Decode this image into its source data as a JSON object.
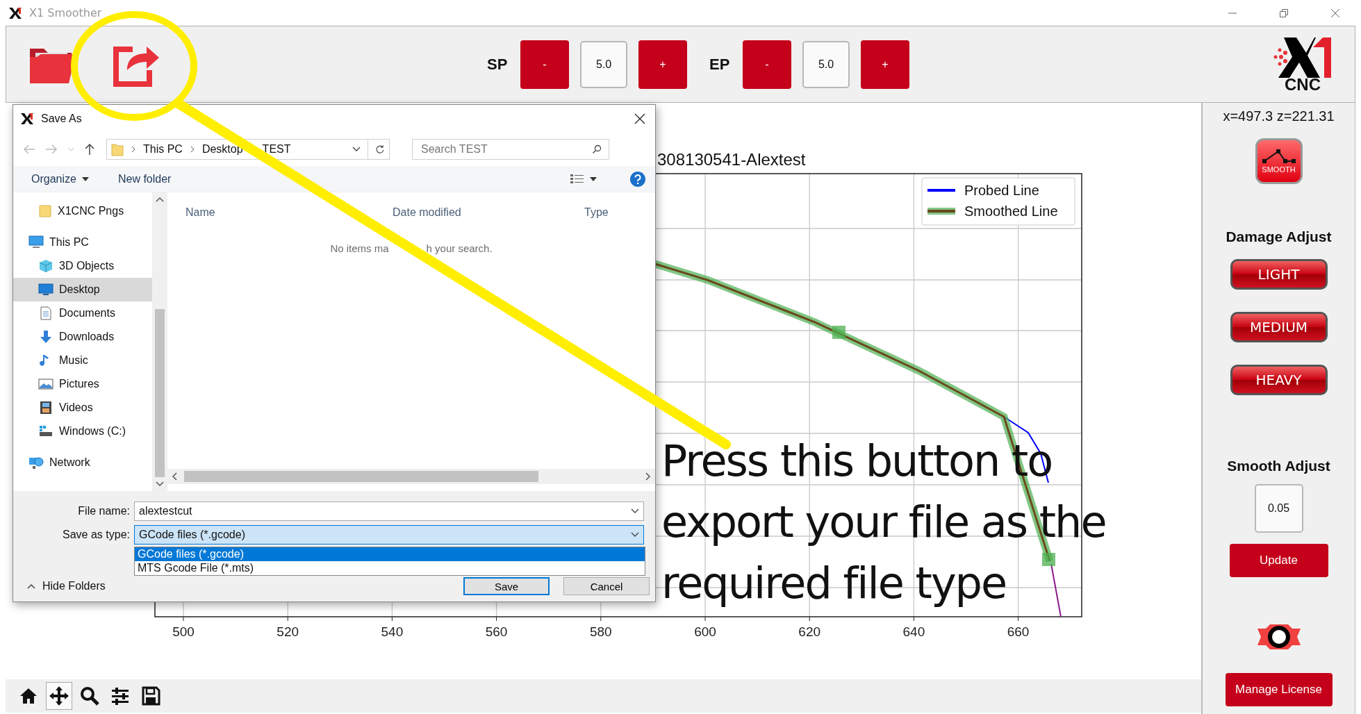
{
  "window": {
    "title": "X1 Smoother"
  },
  "toolbar": {
    "steppers": [
      {
        "label": "SP",
        "minus": "-",
        "value": "5.0",
        "plus": "+"
      },
      {
        "label": "EP",
        "minus": "-",
        "value": "5.0",
        "plus": "+"
      }
    ],
    "logo_text": "CNC"
  },
  "plot": {
    "title": "308130541-Alextest",
    "legend": [
      {
        "label": "Probed Line",
        "color": "#0000ff"
      },
      {
        "label": "Smoothed Line",
        "color": "#6b4a1e"
      }
    ],
    "x_ticks": [
      "500",
      "520",
      "540",
      "560",
      "580",
      "600",
      "620",
      "640",
      "660"
    ]
  },
  "plot_toolbar": [
    {
      "kind": "home",
      "selected": false
    },
    {
      "kind": "pan",
      "selected": true
    },
    {
      "kind": "zoom",
      "selected": false
    },
    {
      "kind": "configure",
      "selected": false
    },
    {
      "kind": "save",
      "selected": false
    }
  ],
  "side_panel": {
    "coordinates": "x=497.3 z=221.31",
    "smooth_button": "SMOOTH",
    "damage_title": "Damage Adjust",
    "damage_buttons": [
      "LIGHT",
      "MEDIUM",
      "HEAVY"
    ],
    "smooth_title": "Smooth Adjust",
    "smooth_value": "0.05",
    "update_button": "Update",
    "license_button": "Manage License"
  },
  "dialog": {
    "title": "Save As",
    "breadcrumb": [
      "This PC",
      "Desktop",
      "TEST"
    ],
    "search_placeholder": "Search TEST",
    "organize": "Organize",
    "new_folder": "New folder",
    "pinned": [
      {
        "label": "X1CNC Pngs",
        "kind": "folder",
        "selected": false
      }
    ],
    "tree": [
      {
        "label": "This PC",
        "kind": "pc",
        "selected": false,
        "children": [
          {
            "label": "3D Objects",
            "kind": "cube",
            "selected": false
          },
          {
            "label": "Desktop",
            "kind": "desktop",
            "selected": true
          },
          {
            "label": "Documents",
            "kind": "document",
            "selected": false
          },
          {
            "label": "Downloads",
            "kind": "download",
            "selected": false
          },
          {
            "label": "Music",
            "kind": "music",
            "selected": false
          },
          {
            "label": "Pictures",
            "kind": "pictures",
            "selected": false
          },
          {
            "label": "Videos",
            "kind": "videos",
            "selected": false
          },
          {
            "label": "Windows (C:)",
            "kind": "drive",
            "selected": false
          }
        ]
      },
      {
        "label": "Network",
        "kind": "network",
        "selected": false
      }
    ],
    "columns": [
      "Name",
      "Date modified",
      "Type"
    ],
    "empty_message": [
      "No items ma",
      "h your search."
    ],
    "file_name_label": "File name:",
    "file_name": "alextestcut",
    "type_label": "Save as type:",
    "type_value": "GCode files (*.gcode)",
    "type_options": [
      {
        "label": "GCode files (*.gcode)",
        "selected": true
      },
      {
        "label": "MTS Gcode File (*.mts)",
        "selected": false
      }
    ],
    "save": "Save",
    "cancel": "Cancel",
    "hide_folders": "Hide Folders"
  },
  "annotation": {
    "lines": [
      "Press this button to",
      "export your file as the",
      "required file type"
    ]
  }
}
